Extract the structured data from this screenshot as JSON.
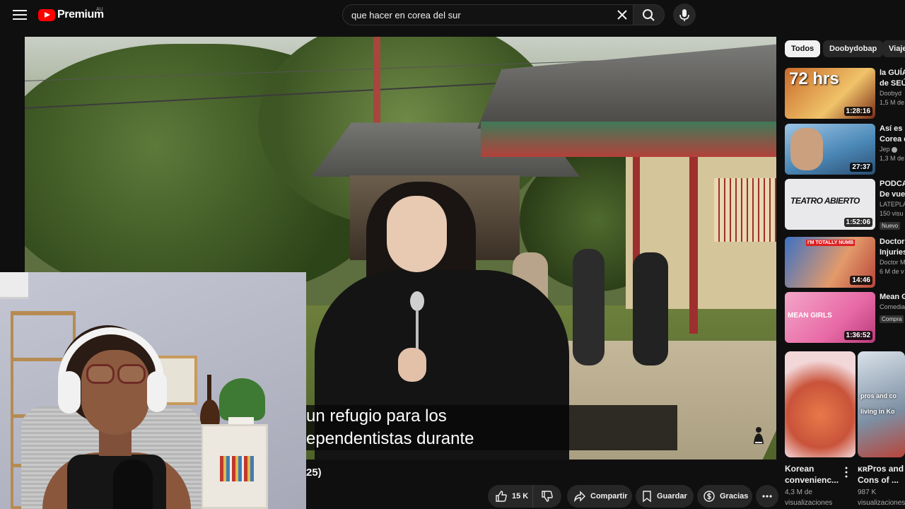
{
  "brand": {
    "name": "Premium",
    "region": "AU"
  },
  "search": {
    "query": "que hacer en corea del sur"
  },
  "player": {
    "subtitle_lines": [
      "un refugio para los",
      "ependentistas durante"
    ]
  },
  "video": {
    "title_fragment": "25)"
  },
  "actions": {
    "likes": "15 K",
    "share_label": "Compartir",
    "save_label": "Guardar",
    "thanks_label": "Gracias"
  },
  "chips": [
    "Todos",
    "Doobydobap",
    "Viaje"
  ],
  "recommendations": [
    {
      "title": "la GUÍA",
      "title2": "de SEÚ",
      "channel": "Doobyd",
      "meta": "1,5 M de",
      "duration": "1:28:16",
      "thumb_color": "#c96a2a"
    },
    {
      "title": "Así es R",
      "title2": "Corea d",
      "channel": "Jep",
      "meta": "1,3 M de",
      "duration": "27:37",
      "thumb_color": "#4c89b8"
    },
    {
      "title": "PODCA",
      "title2": "De vuel",
      "channel": "LATEPLA",
      "meta": "150 visu",
      "badge": "Nuevo",
      "duration": "1:52:06",
      "thumb_color": "#e9e9ec"
    },
    {
      "title": "Doctor I",
      "title2": "Injuries",
      "channel": "Doctor M",
      "meta": "6 M de v",
      "duration": "14:46",
      "thumb_color": "#3d71c4"
    },
    {
      "title": "Mean G",
      "title2": "",
      "channel": "Comedia",
      "meta": "",
      "badge": "Compra",
      "duration": "1:36:52",
      "thumb_color": "#e86aa6"
    }
  ],
  "thumb_text": {
    "rec1": "72 hrs",
    "rec3": "TEATRO ABIERTO",
    "rec4": "I'M TOTALLY NUMB",
    "rec5": "MEAN GIRLS"
  },
  "shorts": [
    {
      "title": "Korean",
      "title2": "convenienc...",
      "meta": "4,3 M de",
      "meta2": "visualizaciones"
    },
    {
      "title": "ᴋʀPros and",
      "title2": "Cons of ...",
      "meta": "987 K",
      "meta2": "visualizaciones",
      "overlay": "pros and co",
      "overlay2": "living in Ko"
    }
  ],
  "colors": {
    "accent": "#ff0000",
    "background": "#0f0f0f",
    "chip_bg": "#272727"
  }
}
